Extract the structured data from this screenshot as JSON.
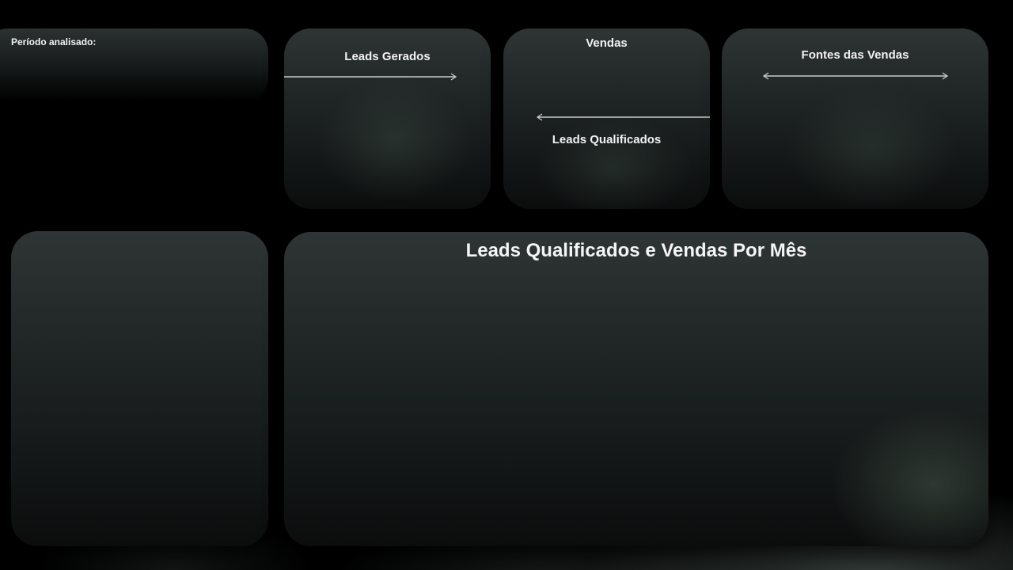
{
  "period": {
    "label": "Período analisado:"
  },
  "cards": {
    "leads_gerados": {
      "title": "Leads Gerados"
    },
    "vendas": {
      "title": "Vendas",
      "subtitle": "Leads Qualificados"
    },
    "fontes": {
      "title": "Fontes das Vendas"
    }
  },
  "main_chart": {
    "title": "Leads Qualificados e Vendas Por Mês"
  },
  "colors": {
    "background": "#000000",
    "card_top": "#2e3534",
    "card_bottom": "#0b0d0d",
    "text": "#f2f2f2",
    "arrow": "#c8cccb"
  },
  "icons": {
    "leads_arrow": "arrow-right-icon",
    "vendas_arrow": "arrow-left-icon",
    "fontes_arrow": "double-arrow-icon"
  }
}
